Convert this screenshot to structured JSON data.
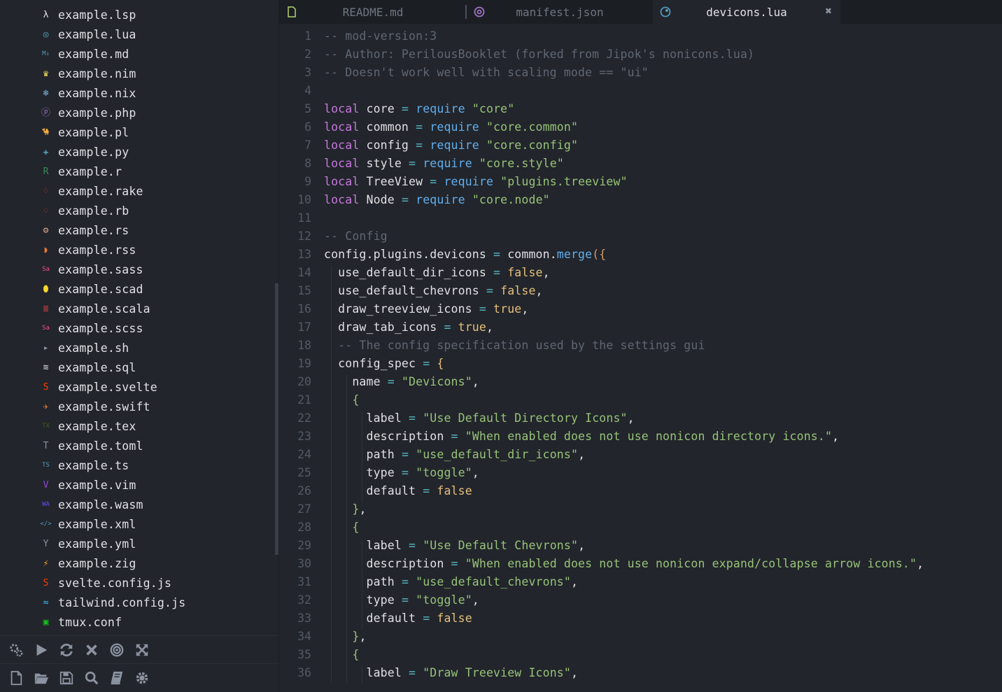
{
  "sidebar": {
    "files": [
      {
        "name": "example.lsp",
        "icon": "lisp-icon",
        "color": "#e1e1e6",
        "glyph": "λ"
      },
      {
        "name": "example.lua",
        "icon": "lua-icon",
        "color": "#519aba",
        "glyph": "◎"
      },
      {
        "name": "example.md",
        "icon": "markdown-icon",
        "color": "#519aba",
        "glyph": "M↓"
      },
      {
        "name": "example.nim",
        "icon": "nim-icon",
        "color": "#f1e05a",
        "glyph": "♛"
      },
      {
        "name": "example.nix",
        "icon": "nix-icon",
        "color": "#7eb6e5",
        "glyph": "❄"
      },
      {
        "name": "example.php",
        "icon": "php-icon",
        "color": "#a074c4",
        "glyph": "ⓟ"
      },
      {
        "name": "example.pl",
        "icon": "perl-icon",
        "color": "#519aba",
        "glyph": "🐪"
      },
      {
        "name": "example.py",
        "icon": "python-icon",
        "color": "#519aba",
        "glyph": "✚"
      },
      {
        "name": "example.r",
        "icon": "r-icon",
        "color": "#358a5b",
        "glyph": "R"
      },
      {
        "name": "example.rake",
        "icon": "ruby-icon",
        "color": "#cc3e44",
        "glyph": "♢"
      },
      {
        "name": "example.rb",
        "icon": "ruby-icon",
        "color": "#cc3e44",
        "glyph": "♢"
      },
      {
        "name": "example.rs",
        "icon": "rust-icon",
        "color": "#dea584",
        "glyph": "⚙"
      },
      {
        "name": "example.rss",
        "icon": "rss-icon",
        "color": "#e37933",
        "glyph": "◗"
      },
      {
        "name": "example.sass",
        "icon": "sass-icon",
        "color": "#f55385",
        "glyph": "Sa"
      },
      {
        "name": "example.scad",
        "icon": "openscad-icon",
        "color": "#f9d72c",
        "glyph": "⬮"
      },
      {
        "name": "example.scala",
        "icon": "scala-icon",
        "color": "#cc3e44",
        "glyph": "≣"
      },
      {
        "name": "example.scss",
        "icon": "scss-icon",
        "color": "#f55385",
        "glyph": "Sa"
      },
      {
        "name": "example.sh",
        "icon": "terminal-icon",
        "color": "#8b93a1",
        "glyph": "▸"
      },
      {
        "name": "example.sql",
        "icon": "database-icon",
        "color": "#dad8d8",
        "glyph": "≋"
      },
      {
        "name": "example.svelte",
        "icon": "svelte-icon",
        "color": "#ff3e00",
        "glyph": "S"
      },
      {
        "name": "example.swift",
        "icon": "swift-icon",
        "color": "#e37933",
        "glyph": "✈"
      },
      {
        "name": "example.tex",
        "icon": "tex-icon",
        "color": "#3d6117",
        "glyph": "TX"
      },
      {
        "name": "example.toml",
        "icon": "toml-icon",
        "color": "#8b93a1",
        "glyph": "T"
      },
      {
        "name": "example.ts",
        "icon": "typescript-icon",
        "color": "#519aba",
        "glyph": "TS"
      },
      {
        "name": "example.vim",
        "icon": "vim-icon",
        "color": "#8f48d8",
        "glyph": "V"
      },
      {
        "name": "example.wasm",
        "icon": "wasm-icon",
        "color": "#654ff0",
        "glyph": "WA"
      },
      {
        "name": "example.xml",
        "icon": "xml-icon",
        "color": "#519aba",
        "glyph": "</>"
      },
      {
        "name": "example.yml",
        "icon": "yaml-icon",
        "color": "#8b93a1",
        "glyph": "Y"
      },
      {
        "name": "example.zig",
        "icon": "zig-icon",
        "color": "#f7a41d",
        "glyph": "⚡"
      },
      {
        "name": "svelte.config.js",
        "icon": "svelte-icon",
        "color": "#ff3e00",
        "glyph": "S"
      },
      {
        "name": "tailwind.config.js",
        "icon": "tailwind-icon",
        "color": "#38bdf8",
        "glyph": "≈"
      },
      {
        "name": "tmux.conf",
        "icon": "tmux-icon",
        "color": "#1bb91f",
        "glyph": "▣"
      }
    ]
  },
  "toolbar_top": [
    "settings-icon",
    "run-icon",
    "reload-icon",
    "close-icon",
    "target-icon",
    "fullscreen-icon"
  ],
  "toolbar_bottom": [
    "new-file-icon",
    "open-folder-icon",
    "save-icon",
    "search-icon",
    "book-icon",
    "gear-icon"
  ],
  "tabs": [
    {
      "label": "README.md",
      "icon": "file-icon"
    },
    {
      "label": "manifest.json",
      "icon": "json-icon"
    },
    {
      "label": "devicons.lua",
      "icon": "lua-icon",
      "active": true,
      "close": "✖"
    }
  ],
  "code": [
    [
      [
        "-- mod-version:3",
        "comment"
      ]
    ],
    [
      [
        "-- Author: PerilousBooklet (forked from Jipok's nonicons.lua)",
        "comment"
      ]
    ],
    [
      [
        "-- Doesn't work well with scaling mode == \"ui\"",
        "comment"
      ]
    ],
    [],
    [
      [
        "local",
        "kw"
      ],
      [
        " core ",
        ""
      ],
      [
        "=",
        "op"
      ],
      [
        " ",
        ""
      ],
      [
        "require",
        "fn"
      ],
      [
        " ",
        ""
      ],
      [
        "\"core\"",
        "str"
      ]
    ],
    [
      [
        "local",
        "kw"
      ],
      [
        " common ",
        ""
      ],
      [
        "=",
        "op"
      ],
      [
        " ",
        ""
      ],
      [
        "require",
        "fn"
      ],
      [
        " ",
        ""
      ],
      [
        "\"core.common\"",
        "str"
      ]
    ],
    [
      [
        "local",
        "kw"
      ],
      [
        " config ",
        ""
      ],
      [
        "=",
        "op"
      ],
      [
        " ",
        ""
      ],
      [
        "require",
        "fn"
      ],
      [
        " ",
        ""
      ],
      [
        "\"core.config\"",
        "str"
      ]
    ],
    [
      [
        "local",
        "kw"
      ],
      [
        " style ",
        ""
      ],
      [
        "=",
        "op"
      ],
      [
        " ",
        ""
      ],
      [
        "require",
        "fn"
      ],
      [
        " ",
        ""
      ],
      [
        "\"core.style\"",
        "str"
      ]
    ],
    [
      [
        "local",
        "kw"
      ],
      [
        " TreeView ",
        ""
      ],
      [
        "=",
        "op"
      ],
      [
        " ",
        ""
      ],
      [
        "require",
        "fn"
      ],
      [
        " ",
        ""
      ],
      [
        "\"plugins.treeview\"",
        "str"
      ]
    ],
    [
      [
        "local",
        "kw"
      ],
      [
        " Node ",
        ""
      ],
      [
        "=",
        "op"
      ],
      [
        " ",
        ""
      ],
      [
        "require",
        "fn"
      ],
      [
        " ",
        ""
      ],
      [
        "\"core.node\"",
        "str"
      ]
    ],
    [],
    [
      [
        "-- Config",
        "comment"
      ]
    ],
    [
      [
        "config.plugins.devicons ",
        ""
      ],
      [
        "=",
        "op"
      ],
      [
        " common.",
        ""
      ],
      [
        "merge",
        "fn"
      ],
      [
        "({",
        "paren"
      ]
    ],
    [
      [
        "  use_default_dir_icons ",
        ""
      ],
      [
        "=",
        "op"
      ],
      [
        " ",
        ""
      ],
      [
        "false",
        "bool"
      ],
      [
        ",",
        ""
      ]
    ],
    [
      [
        "  use_default_chevrons ",
        ""
      ],
      [
        "=",
        "op"
      ],
      [
        " ",
        ""
      ],
      [
        "false",
        "bool"
      ],
      [
        ",",
        ""
      ]
    ],
    [
      [
        "  draw_treeview_icons ",
        ""
      ],
      [
        "=",
        "op"
      ],
      [
        " ",
        ""
      ],
      [
        "true",
        "bool"
      ],
      [
        ",",
        ""
      ]
    ],
    [
      [
        "  draw_tab_icons ",
        ""
      ],
      [
        "=",
        "op"
      ],
      [
        " ",
        ""
      ],
      [
        "true",
        "bool"
      ],
      [
        ",",
        ""
      ]
    ],
    [
      [
        "  ",
        ""
      ],
      [
        "-- The config specification used by the settings gui",
        "comment"
      ]
    ],
    [
      [
        "  config_spec ",
        ""
      ],
      [
        "=",
        "op"
      ],
      [
        " ",
        ""
      ],
      [
        "{",
        "bool"
      ]
    ],
    [
      [
        "    name ",
        ""
      ],
      [
        "=",
        "op"
      ],
      [
        " ",
        ""
      ],
      [
        "\"Devicons\"",
        "str"
      ],
      [
        ",",
        ""
      ]
    ],
    [
      [
        "    ",
        ""
      ],
      [
        "{",
        "str"
      ]
    ],
    [
      [
        "      label ",
        ""
      ],
      [
        "=",
        "op"
      ],
      [
        " ",
        ""
      ],
      [
        "\"Use Default Directory Icons\"",
        "str"
      ],
      [
        ",",
        ""
      ]
    ],
    [
      [
        "      description ",
        ""
      ],
      [
        "=",
        "op"
      ],
      [
        " ",
        ""
      ],
      [
        "\"When enabled does not use nonicon directory icons.\"",
        "str"
      ],
      [
        ",",
        ""
      ]
    ],
    [
      [
        "      path ",
        ""
      ],
      [
        "=",
        "op"
      ],
      [
        " ",
        ""
      ],
      [
        "\"use_default_dir_icons\"",
        "str"
      ],
      [
        ",",
        ""
      ]
    ],
    [
      [
        "      type ",
        ""
      ],
      [
        "=",
        "op"
      ],
      [
        " ",
        ""
      ],
      [
        "\"toggle\"",
        "str"
      ],
      [
        ",",
        ""
      ]
    ],
    [
      [
        "      default ",
        ""
      ],
      [
        "=",
        "op"
      ],
      [
        " ",
        ""
      ],
      [
        "false",
        "bool"
      ]
    ],
    [
      [
        "    ",
        ""
      ],
      [
        "}",
        "str"
      ],
      [
        ",",
        ""
      ]
    ],
    [
      [
        "    ",
        ""
      ],
      [
        "{",
        "str"
      ]
    ],
    [
      [
        "      label ",
        ""
      ],
      [
        "=",
        "op"
      ],
      [
        " ",
        ""
      ],
      [
        "\"Use Default Chevrons\"",
        "str"
      ],
      [
        ",",
        ""
      ]
    ],
    [
      [
        "      description ",
        ""
      ],
      [
        "=",
        "op"
      ],
      [
        " ",
        ""
      ],
      [
        "\"When enabled does not use nonicon expand/collapse arrow icons.\"",
        "str"
      ],
      [
        ",",
        ""
      ]
    ],
    [
      [
        "      path ",
        ""
      ],
      [
        "=",
        "op"
      ],
      [
        " ",
        ""
      ],
      [
        "\"use_default_chevrons\"",
        "str"
      ],
      [
        ",",
        ""
      ]
    ],
    [
      [
        "      type ",
        ""
      ],
      [
        "=",
        "op"
      ],
      [
        " ",
        ""
      ],
      [
        "\"toggle\"",
        "str"
      ],
      [
        ",",
        ""
      ]
    ],
    [
      [
        "      default ",
        ""
      ],
      [
        "=",
        "op"
      ],
      [
        " ",
        ""
      ],
      [
        "false",
        "bool"
      ]
    ],
    [
      [
        "    ",
        ""
      ],
      [
        "}",
        "str"
      ],
      [
        ",",
        ""
      ]
    ],
    [
      [
        "    ",
        ""
      ],
      [
        "{",
        "str"
      ]
    ],
    [
      [
        "      label ",
        ""
      ],
      [
        "=",
        "op"
      ],
      [
        " ",
        ""
      ],
      [
        "\"Draw Treeview Icons\"",
        "str"
      ],
      [
        ",",
        ""
      ]
    ]
  ],
  "line_numbers": [
    "1",
    "2",
    "3",
    "4",
    "5",
    "6",
    "7",
    "8",
    "9",
    "10",
    "11",
    "12",
    "13",
    "14",
    "15",
    "16",
    "17",
    "18",
    "19",
    "20",
    "21",
    "22",
    "23",
    "24",
    "25",
    "26",
    "27",
    "28",
    "29",
    "30",
    "31",
    "32",
    "33",
    "34",
    "35",
    "36"
  ]
}
